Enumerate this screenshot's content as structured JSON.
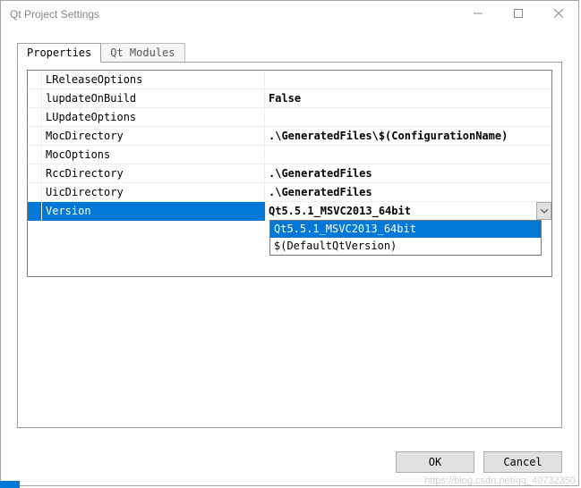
{
  "window": {
    "title": "Qt Project Settings"
  },
  "tabs": {
    "active": "Properties",
    "items": [
      "Properties",
      "Qt Modules"
    ]
  },
  "properties": [
    {
      "name": "LReleaseOptions",
      "value": "",
      "bold": false
    },
    {
      "name": "lupdateOnBuild",
      "value": "False",
      "bold": true
    },
    {
      "name": "LUpdateOptions",
      "value": "",
      "bold": false
    },
    {
      "name": "MocDirectory",
      "value": ".\\GeneratedFiles\\$(ConfigurationName)",
      "bold": true
    },
    {
      "name": "MocOptions",
      "value": "",
      "bold": false
    },
    {
      "name": "RccDirectory",
      "value": ".\\GeneratedFiles",
      "bold": true
    },
    {
      "name": "UicDirectory",
      "value": ".\\GeneratedFiles",
      "bold": true
    },
    {
      "name": "Version",
      "value": "Qt5.5.1_MSVC2013_64bit",
      "bold": true,
      "selected": true,
      "dropdown": true
    }
  ],
  "dropdown": {
    "options": [
      "Qt5.5.1_MSVC2013_64bit",
      "$(DefaultQtVersion)"
    ],
    "highlighted": 0
  },
  "buttons": {
    "ok": "OK",
    "cancel": "Cancel"
  },
  "watermark": "https://blog.csdn.net/qq_40732350"
}
